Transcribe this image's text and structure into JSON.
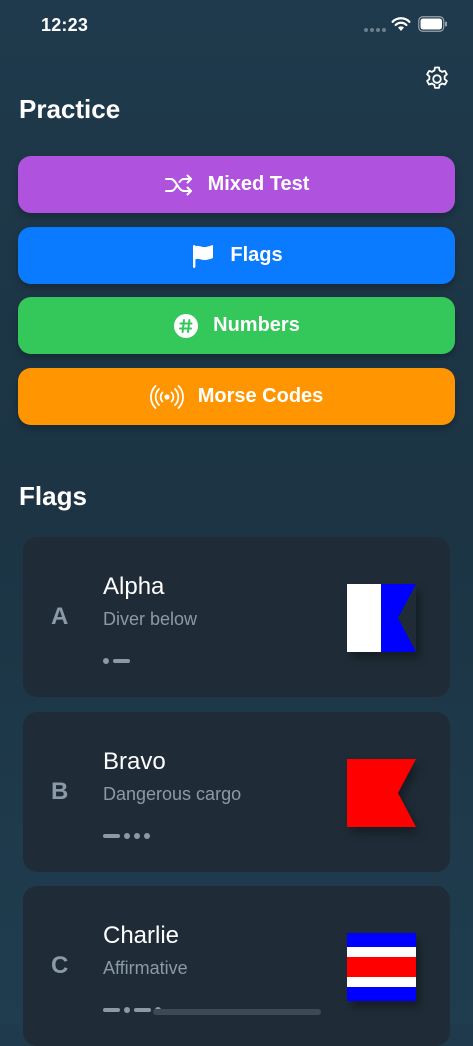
{
  "status_bar": {
    "time": "12:23",
    "icons": [
      "signal-icon",
      "wifi-icon",
      "battery-icon"
    ]
  },
  "header": {
    "settings_icon": "gear-icon"
  },
  "practice": {
    "title": "Practice",
    "buttons": [
      {
        "label": "Mixed Test",
        "icon": "shuffle-icon",
        "color": "#af52de"
      },
      {
        "label": "Flags",
        "icon": "flag-icon",
        "color": "#0a7aff"
      },
      {
        "label": "Numbers",
        "icon": "number-icon",
        "color": "#34c759"
      },
      {
        "label": "Morse Codes",
        "icon": "broadcast-icon",
        "color": "#ff9500"
      }
    ]
  },
  "flags": {
    "title": "Flags",
    "items": [
      {
        "letter": "A",
        "name": "Alpha",
        "meaning": "Diver below",
        "morse": ".-"
      },
      {
        "letter": "B",
        "name": "Bravo",
        "meaning": "Dangerous cargo",
        "morse": "-..."
      },
      {
        "letter": "C",
        "name": "Charlie",
        "meaning": "Affirmative",
        "morse": "-.-."
      }
    ]
  },
  "colors": {
    "background": "#1c3444",
    "card": "#1f2c37",
    "flag_blue": "#0000ff",
    "flag_red": "#ff0000",
    "flag_white": "#ffffff"
  }
}
